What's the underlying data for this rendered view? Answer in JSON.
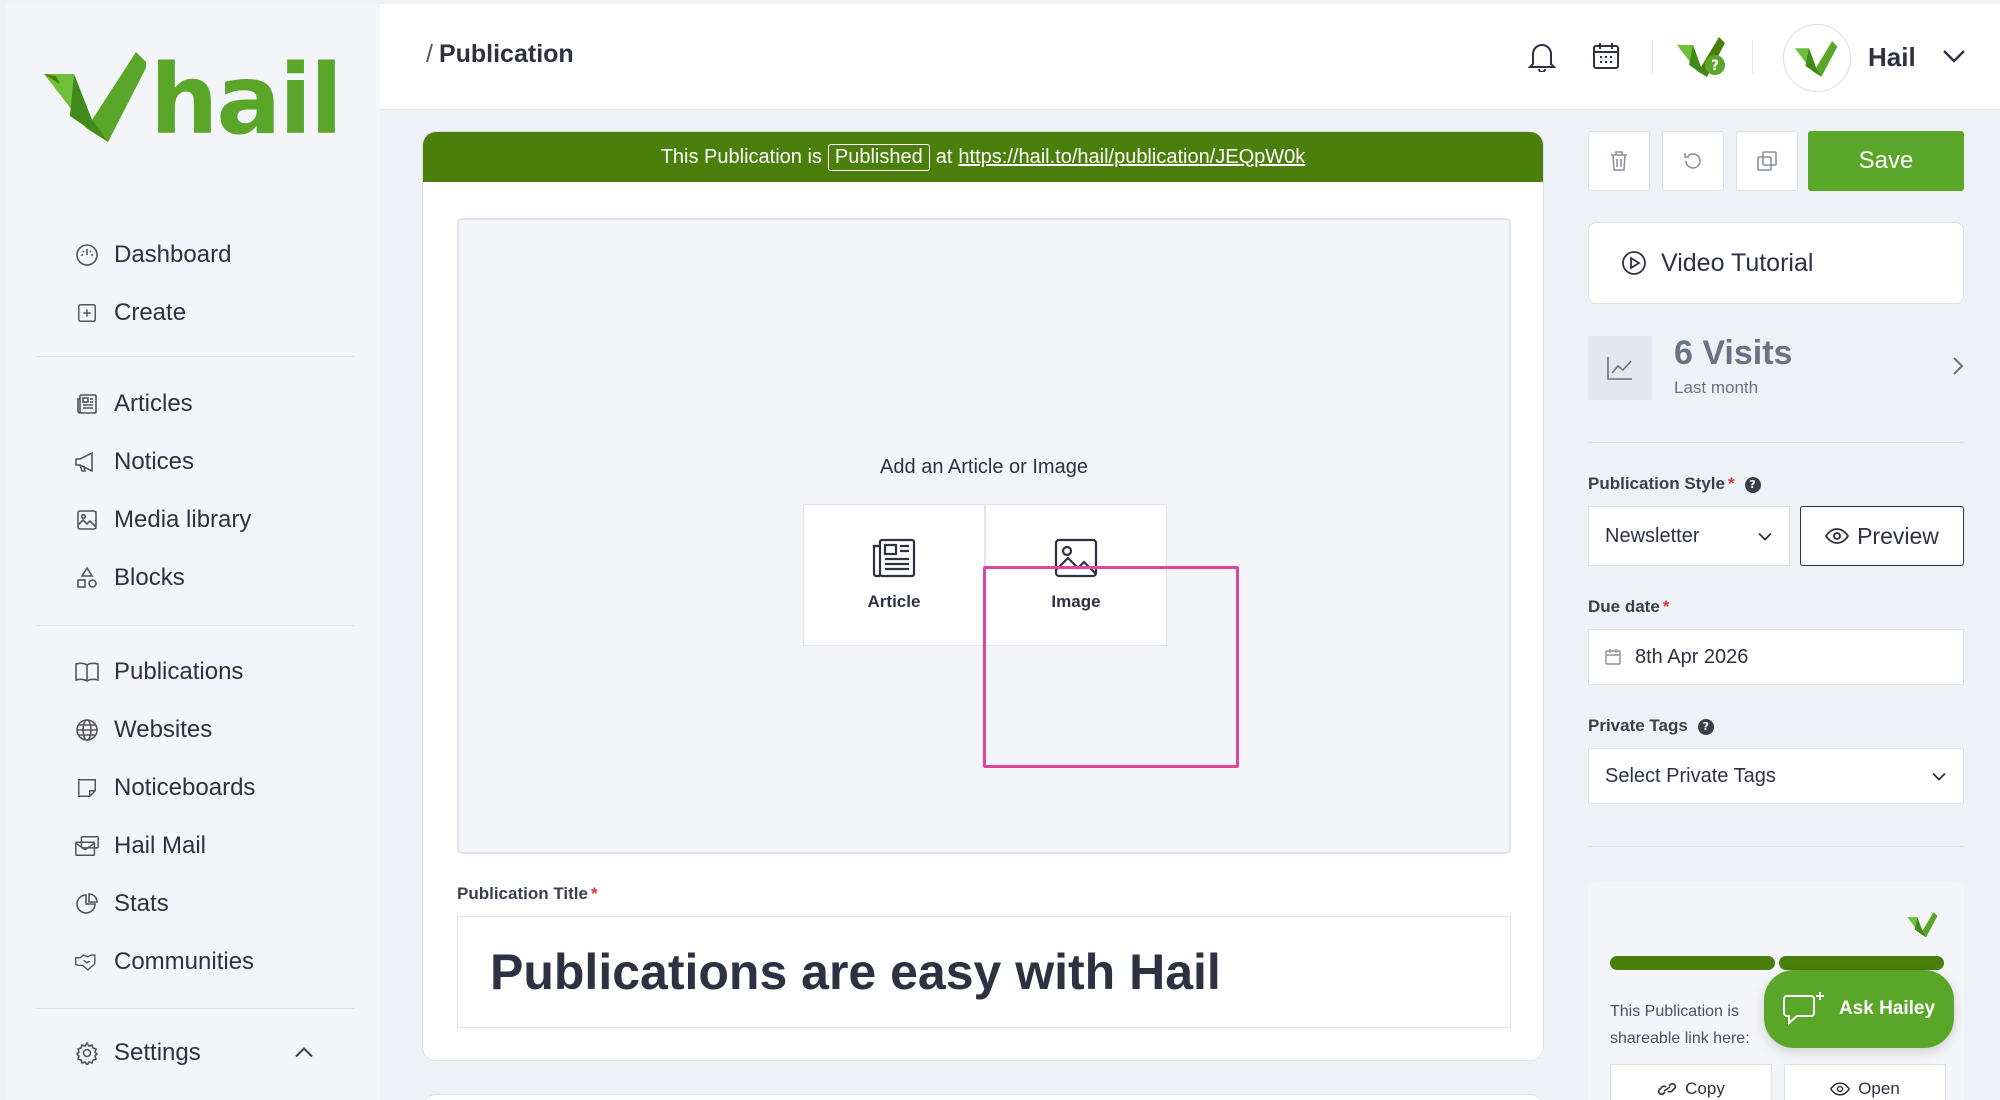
{
  "app": {
    "name": "hail"
  },
  "sidebar": {
    "group1": [
      {
        "label": "Dashboard",
        "icon": "dashboard-icon"
      },
      {
        "label": "Create",
        "icon": "plus-square-icon"
      }
    ],
    "group2": [
      {
        "label": "Articles",
        "icon": "newspaper-icon"
      },
      {
        "label": "Notices",
        "icon": "megaphone-icon"
      },
      {
        "label": "Media library",
        "icon": "image-icon"
      },
      {
        "label": "Blocks",
        "icon": "shapes-icon"
      }
    ],
    "group3": [
      {
        "label": "Publications",
        "icon": "book-icon"
      },
      {
        "label": "Websites",
        "icon": "globe-icon"
      },
      {
        "label": "Noticeboards",
        "icon": "note-icon"
      },
      {
        "label": "Hail Mail",
        "icon": "mail-icon"
      },
      {
        "label": "Stats",
        "icon": "pie-chart-icon"
      },
      {
        "label": "Communities",
        "icon": "handshake-icon"
      }
    ],
    "settings": {
      "label": "Settings",
      "icon": "gear-icon"
    }
  },
  "header": {
    "breadcrumb_sep": "/",
    "breadcrumb": "Publication",
    "user_name": "Hail"
  },
  "banner": {
    "prefix": "This Publication is",
    "status": "Published",
    "at": "at",
    "url": "https://hail.to/hail/publication/JEQpW0k"
  },
  "dropzone": {
    "title": "Add an Article or Image",
    "options": [
      {
        "label": "Article",
        "icon": "article-icon"
      },
      {
        "label": "Image",
        "icon": "image-icon"
      }
    ]
  },
  "title_field": {
    "label": "Publication Title",
    "value": "Publications are easy with Hail"
  },
  "actions": {
    "save": "Save"
  },
  "video_tutorial": {
    "label": "Video Tutorial"
  },
  "visits": {
    "count": "6 Visits",
    "period": "Last month"
  },
  "publication_style": {
    "label": "Publication Style",
    "value": "Newsletter",
    "preview": "Preview"
  },
  "due_date": {
    "label": "Due date",
    "value": "8th Apr 2026"
  },
  "private_tags": {
    "label": "Private Tags",
    "placeholder": "Select Private Tags"
  },
  "share": {
    "line1": "This Publication is",
    "line2": "shareable link here:",
    "copy": "Copy",
    "open": "Open"
  },
  "ask_hailey": {
    "label": "Ask Hailey"
  },
  "colors": {
    "brand_green": "#5aa628",
    "banner_green": "#4a7f0b",
    "highlight_pink": "#e0459b"
  }
}
